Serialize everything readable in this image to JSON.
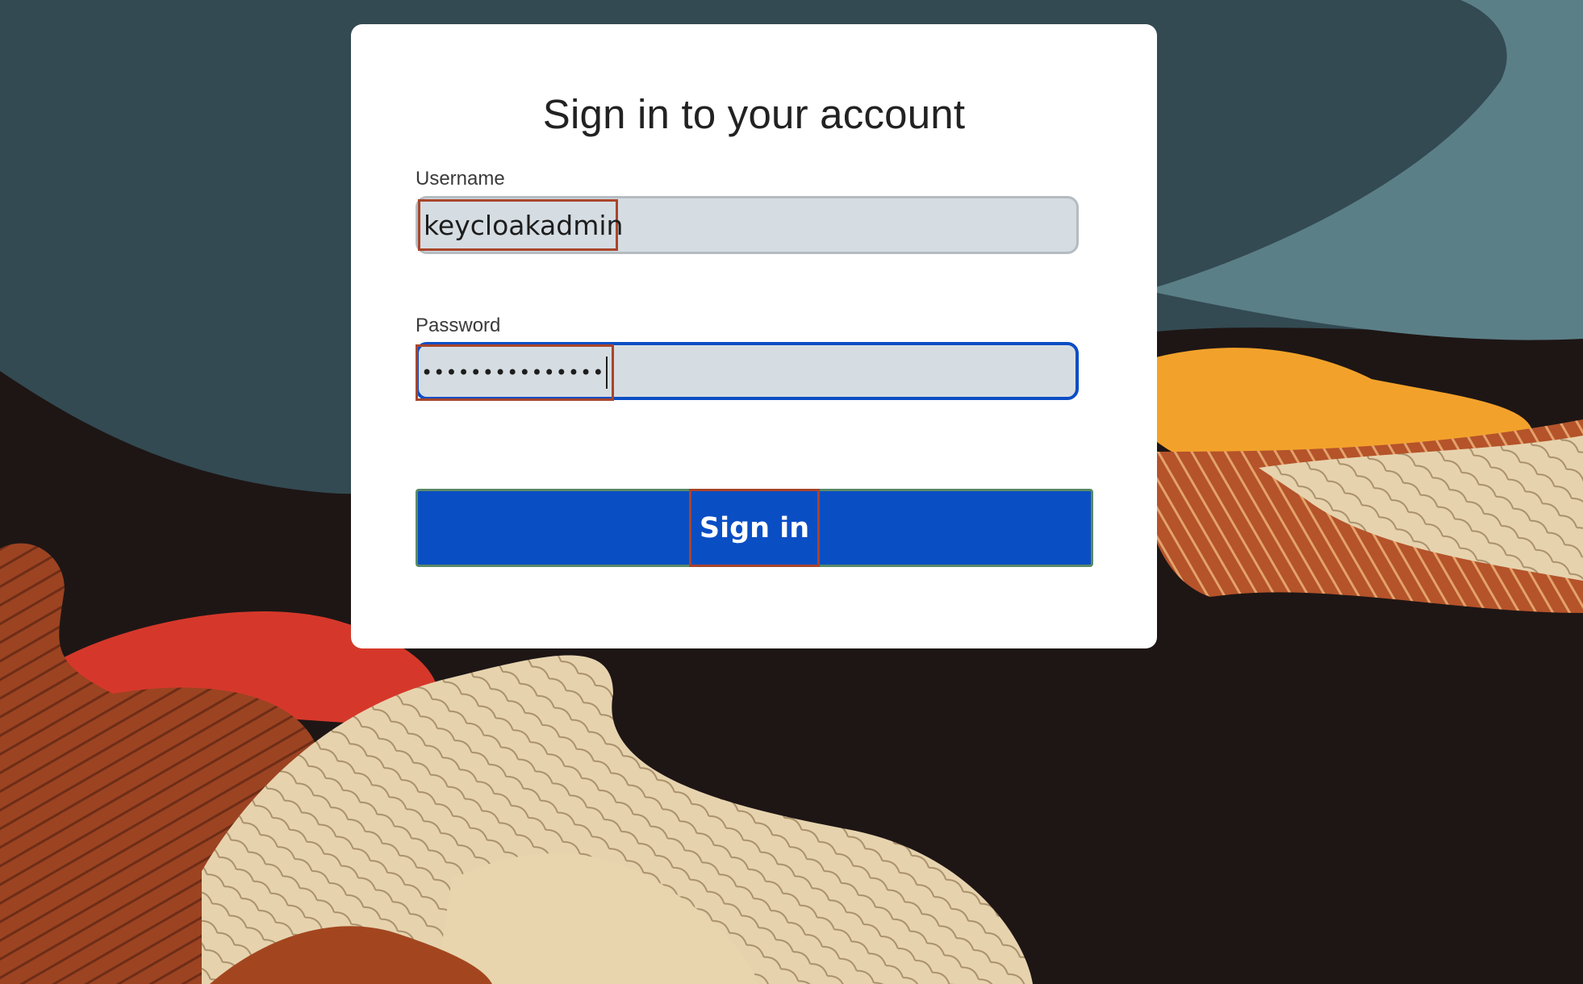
{
  "login": {
    "title": "Sign in to your account",
    "username_label": "Username",
    "username_value": "keycloakadmin",
    "password_label": "Password",
    "password_masked": "•••••••••••••••",
    "submit_label": "Sign in"
  },
  "colors": {
    "primary": "#0a4ec4",
    "input_bg": "#d5dde3",
    "card_bg": "#ffffff",
    "highlight_border": "#a9452a"
  }
}
